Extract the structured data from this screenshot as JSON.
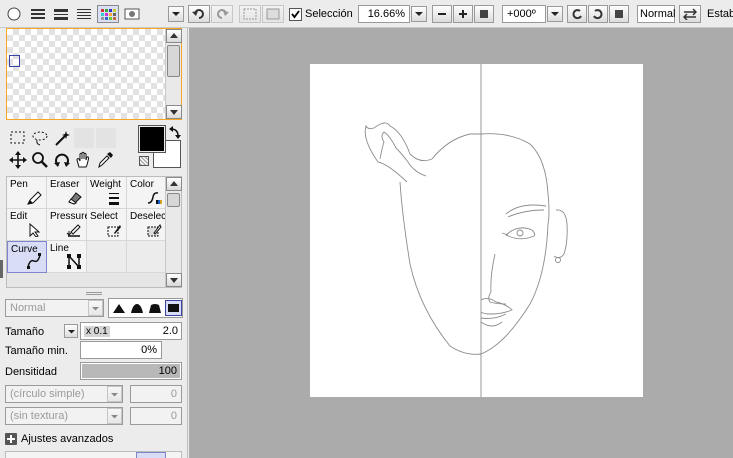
{
  "toolbar": {
    "selection_label": "Selección",
    "zoom": "16.66%",
    "rotation": "+000º",
    "blend_mode": "Normal",
    "stabilizer_label": "Estab"
  },
  "tools": {
    "brushes": [
      {
        "label": "Pen",
        "icon": "pen-icon"
      },
      {
        "label": "Eraser",
        "icon": "eraser-icon"
      },
      {
        "label": "Weight",
        "icon": "weight-icon"
      },
      {
        "label": "Color",
        "icon": "color-icon"
      },
      {
        "label": "Edit",
        "icon": "edit-icon"
      },
      {
        "label": "Pressure",
        "icon": "pressure-icon"
      },
      {
        "label": "Select",
        "icon": "select-icon"
      },
      {
        "label": "Deselect",
        "icon": "deselect-icon"
      },
      {
        "label": "Curve",
        "icon": "curve-icon"
      },
      {
        "label": "Line",
        "icon": "line-icon"
      }
    ],
    "selected_brush": "Curve"
  },
  "settings": {
    "blend": "Normal",
    "size_label": "Tamaño",
    "size_multiplier": "x 0.1",
    "size_value": "2.0",
    "min_size_label": "Tamaño min.",
    "min_size_value": "0%",
    "density_label": "Densitidad",
    "density_value": "100",
    "shape_option": "(círculo simple)",
    "shape_value": "0",
    "texture_option": "(sin textura)",
    "texture_value": "0",
    "advanced_label": "Ajustes avanzados"
  },
  "colors": {
    "primary": "#000000",
    "secondary": "#ffffff",
    "accent": "#2f6fc0",
    "workspace": "#ababab"
  }
}
